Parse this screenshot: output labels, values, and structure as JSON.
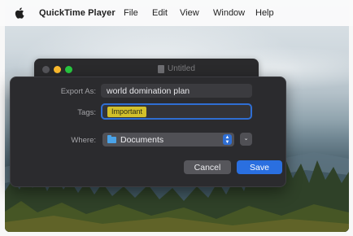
{
  "menubar": {
    "app_name": "QuickTime Player",
    "items": [
      "File",
      "Edit",
      "View",
      "Window",
      "Help"
    ],
    "apple_icon": "apple-logo-icon"
  },
  "background_window": {
    "title": "Untitled",
    "traffic_lights": {
      "close_color": "#ff5f57",
      "minimize_color": "#febc2e",
      "zoom_color": "#28c840"
    }
  },
  "sheet": {
    "export_as_label": "Export As:",
    "export_as_value": "world domination plan",
    "tags_label": "Tags:",
    "tag_chip": "Important",
    "tag_color": "#d3c02a",
    "where_label": "Where:",
    "where_value": "Documents",
    "where_icon": "folder-icon",
    "expand_icon": "chevron-down-icon",
    "cancel_label": "Cancel",
    "save_label": "Save",
    "accent_color": "#2a6fe0"
  }
}
